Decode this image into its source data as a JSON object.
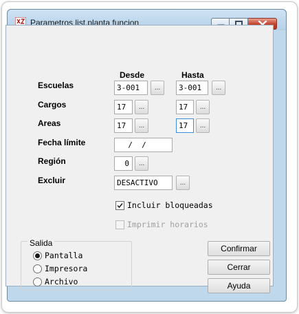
{
  "window": {
    "title": "Parametros list.planta funcion"
  },
  "columns": {
    "desde": "Desde",
    "hasta": "Hasta"
  },
  "fields": {
    "escuelas": {
      "label": "Escuelas",
      "desde": "3-001",
      "hasta": "3-001"
    },
    "cargos": {
      "label": "Cargos",
      "desde": "17",
      "hasta": "17"
    },
    "areas": {
      "label": "Areas",
      "desde": "17",
      "hasta": "17"
    },
    "fecha_limite": {
      "label": "Fecha límite",
      "value": "  /  /"
    },
    "region": {
      "label": "Región",
      "value": "0"
    },
    "excluir": {
      "label": "Excluir",
      "value": "DESACTIVO"
    }
  },
  "ellipsis_label": "...",
  "options": {
    "incluir_bloqueadas": {
      "label": "Incluir bloqueadas",
      "checked": true
    },
    "imprimir_horarios": {
      "label": "Imprimir horarios",
      "checked": false,
      "enabled": false
    }
  },
  "salida": {
    "title": "Salida",
    "options": [
      {
        "label": "Pantalla",
        "selected": true
      },
      {
        "label": "Impresora",
        "selected": false
      },
      {
        "label": "Archivo",
        "selected": false
      }
    ]
  },
  "buttons": {
    "confirmar": "Confirmar",
    "cerrar": "Cerrar",
    "ayuda": "Ayuda"
  },
  "colors": {
    "titlebar": "#bfd8ec",
    "close_button": "#c4402a",
    "focus_border": "#3a8edb"
  }
}
